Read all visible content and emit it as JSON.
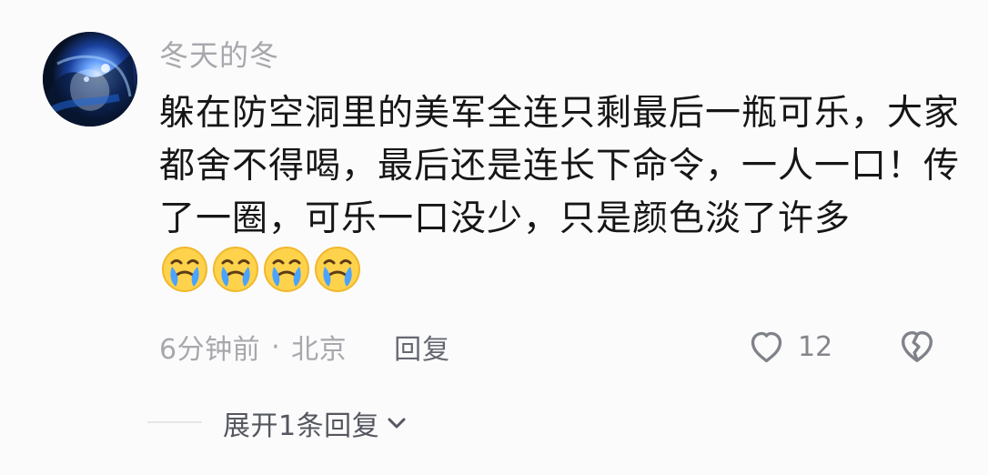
{
  "comment": {
    "username": "冬天的冬",
    "content": "躲在防空洞里的美军全连只剩最后一瓶可乐，大家都舍不得喝，最后还是连长下命令，一人一口！传了一圈，可乐一口没少，只是颜色淡了许多",
    "emojis": [
      "crying-emoji",
      "crying-emoji",
      "crying-emoji",
      "crying-emoji"
    ],
    "meta": {
      "time": "6分钟前",
      "separator": "·",
      "location": "北京",
      "reply_label": "回复"
    },
    "like": {
      "icon": "heart-outline-icon",
      "count": "12"
    },
    "dislike": {
      "icon": "broken-heart-icon"
    },
    "expand_replies": {
      "label": "展开1条回复",
      "icon": "chevron-down-icon"
    }
  },
  "colors": {
    "background": "#fbfbfb",
    "text": "#161616",
    "muted": "#a7a7ad",
    "reply": "#666870",
    "icon": "#80828a",
    "emoji_face": "#ffd24c",
    "emoji_tear": "#4aa3ff"
  }
}
